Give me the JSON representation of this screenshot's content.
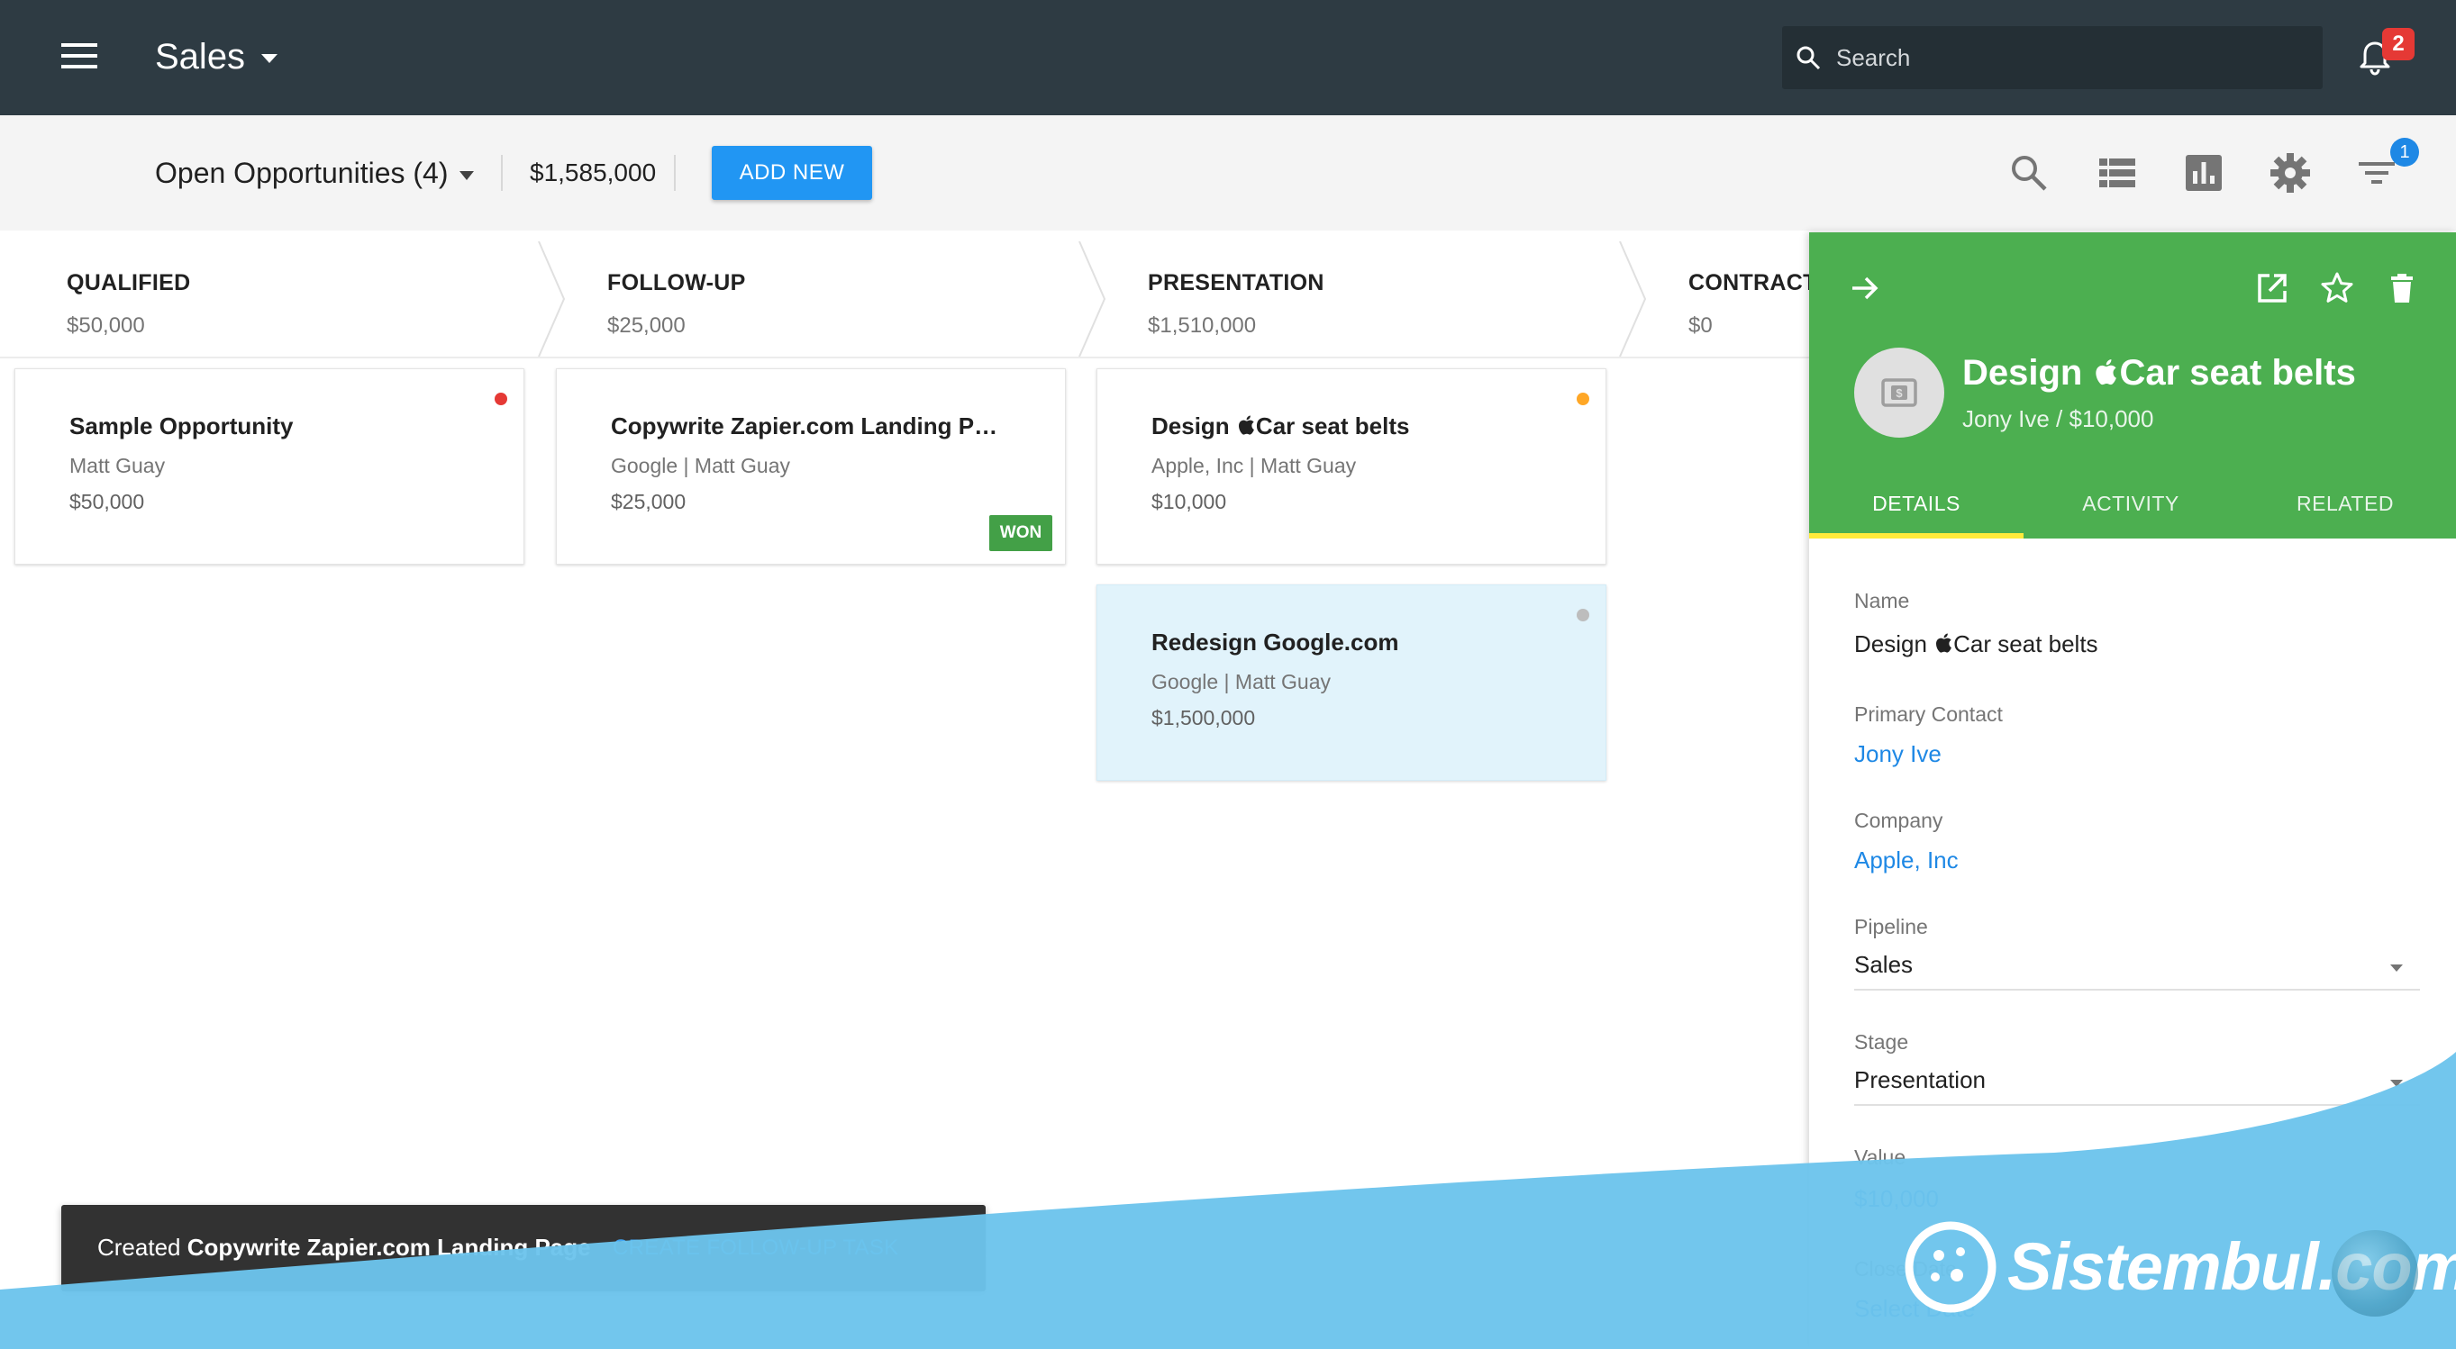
{
  "header": {
    "app_title": "Sales",
    "search_placeholder": "Search",
    "notification_count": "2"
  },
  "toolbar": {
    "view_label": "Open Opportunities (4)",
    "total_value": "$1,585,000",
    "add_new_label": "ADD NEW",
    "filter_count": "1"
  },
  "stages": [
    {
      "name": "QUALIFIED",
      "amount": "$50,000"
    },
    {
      "name": "FOLLOW-UP",
      "amount": "$25,000"
    },
    {
      "name": "PRESENTATION",
      "amount": "$1,510,000"
    },
    {
      "name": "CONTRACT",
      "amount": "$0"
    }
  ],
  "cards": [
    {
      "title": "Sample Opportunity",
      "subtitle": "Matt Guay",
      "value": "$50,000",
      "dot_color": "#e53935"
    },
    {
      "title": "Copywrite Zapier.com Landing P…",
      "subtitle": "Google | Matt Guay",
      "value": "$25,000",
      "badge": "WON"
    },
    {
      "title": "Design Car seat belts",
      "subtitle": "Apple, Inc | Matt Guay",
      "value": "$10,000",
      "dot_color": "#ffa726"
    },
    {
      "title": "Redesign Google.com",
      "subtitle": "Google | Matt Guay",
      "value": "$1,500,000",
      "dot_color": "#bdbdbd"
    }
  ],
  "panel": {
    "title_prefix": "Design ",
    "title_suffix": "Car seat belts",
    "subtitle": "Jony Ive / $10,000",
    "tabs": [
      "DETAILS",
      "ACTIVITY",
      "RELATED"
    ],
    "fields": {
      "name_label": "Name",
      "name_prefix": "Design ",
      "name_suffix": "Car seat belts",
      "contact_label": "Primary Contact",
      "contact_value": "Jony Ive",
      "company_label": "Company",
      "company_value": "Apple, Inc",
      "pipeline_label": "Pipeline",
      "pipeline_value": "Sales",
      "stage_label": "Stage",
      "stage_value": "Presentation",
      "value_label": "Value",
      "value_value": "$10,000",
      "close_label": "Close Date",
      "close_placeholder": "Select Date"
    }
  },
  "snackbar": {
    "prefix": "Created ",
    "bold": "Copywrite Zapier.com Landing Page",
    "action": "CREATE FOLLOW-UP TASK"
  },
  "watermark": {
    "text": "Sistembul.com"
  },
  "colors": {
    "appbar": "#2e3b43",
    "accent": "#2196f3",
    "panel_header": "#4caf50",
    "tab_indicator": "#ffeb3b",
    "won": "#43a047",
    "wave": "#6cc4ec"
  }
}
